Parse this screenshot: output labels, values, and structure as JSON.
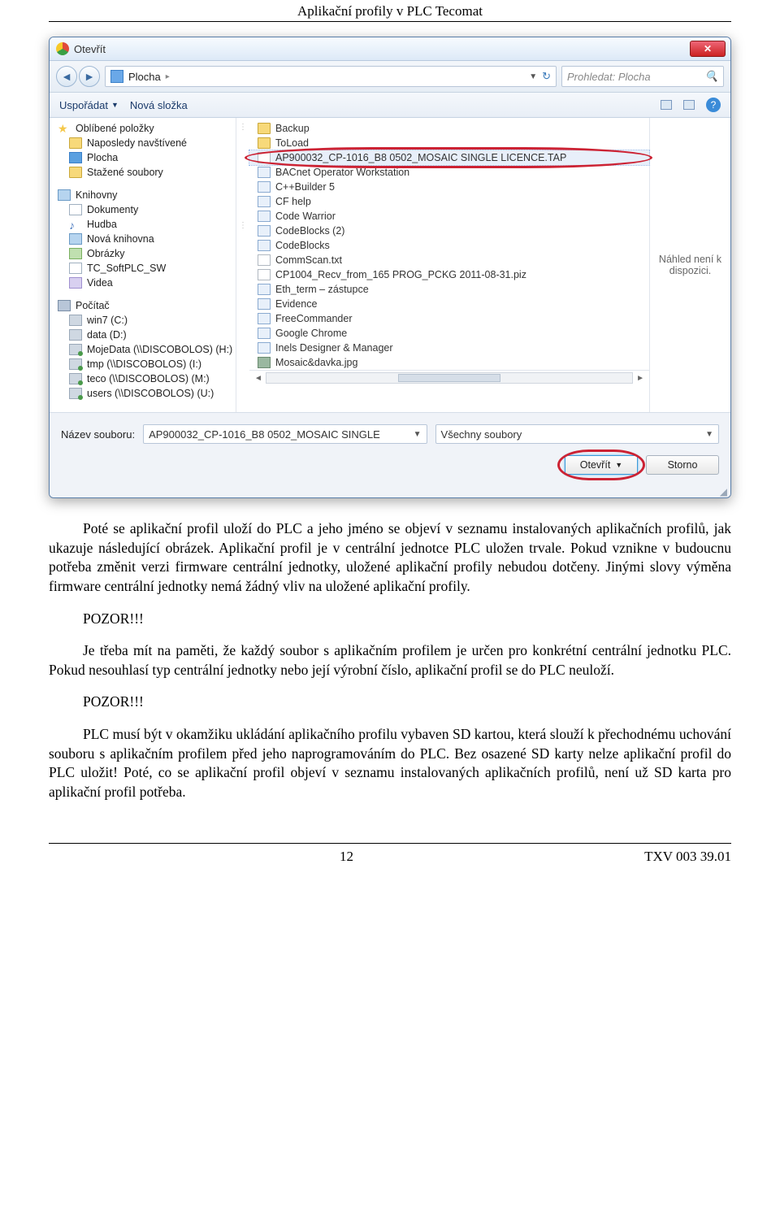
{
  "doc": {
    "header": "Aplikační profily v PLC Tecomat",
    "page_no": "12",
    "footer_code": "TXV 003 39.01"
  },
  "dialog": {
    "title": "Otevřít",
    "breadcrumb": "Plocha",
    "breadcrumb_sep": "▸",
    "search_placeholder": "Prohledat: Plocha",
    "toolbar": {
      "organize": "Uspořádat",
      "newfolder": "Nová složka"
    },
    "sidebar": {
      "favorites": "Oblíbené položky",
      "recent": "Naposledy navštívené",
      "desktop": "Plocha",
      "downloads": "Stažené soubory",
      "libraries": "Knihovny",
      "documents": "Dokumenty",
      "music": "Hudba",
      "newlib": "Nová knihovna",
      "pictures": "Obrázky",
      "tcsoft": "TC_SoftPLC_SW",
      "videos": "Videa",
      "computer": "Počítač",
      "drive_c": "win7 (C:)",
      "drive_d": "data (D:)",
      "net_h": "MojeData (\\\\DISCOBOLOS) (H:)",
      "net_i": "tmp (\\\\DISCOBOLOS) (I:)",
      "net_m": "teco (\\\\DISCOBOLOS) (M:)",
      "net_u": "users (\\\\DISCOBOLOS) (U:)"
    },
    "files": [
      "Backup",
      "ToLoad",
      "AP900032_CP-1016_B8 0502_MOSAIC SINGLE LICENCE.TAP",
      "BACnet Operator Workstation",
      "C++Builder 5",
      "CF help",
      "Code Warrior",
      "CodeBlocks (2)",
      "CodeBlocks",
      "CommScan.txt",
      "CP1004_Recv_from_165 PROG_PCKG 2011-08-31.piz",
      "Eth_term – zástupce",
      "Evidence",
      "FreeCommander",
      "Google Chrome",
      "Inels Designer & Manager",
      "Mosaic&davka.jpg"
    ],
    "selected_index": 2,
    "preview_text": "Náhled není k dispozici.",
    "filename_label": "Název souboru:",
    "filename_value": "AP900032_CP-1016_B8 0502_MOSAIC SINGLE",
    "filter": "Všechny soubory",
    "open_btn": "Otevřít",
    "cancel_btn": "Storno"
  },
  "text": {
    "p1": "Poté se aplikační profil uloží do PLC a jeho jméno se objeví v seznamu instalovaných aplikačních profilů, jak ukazuje následující obrázek. Aplikační profil je v centrální jednotce PLC uložen trvale. Pokud vznikne v budoucnu potřeba změnit verzi firmware centrální jednotky, uložené aplikační profily nebudou dotčeny. Jinými slovy výměna firmware centrální jednotky nemá žádný vliv na uložené aplikační profily.",
    "pozor1": "POZOR!!!",
    "p2": "Je třeba mít na paměti, že každý soubor s aplikačním profilem je určen pro konkrétní centrální jednotku PLC. Pokud nesouhlasí typ centrální jednotky nebo její výrobní číslo, aplikační profil se do PLC neuloží.",
    "pozor2": "POZOR!!!",
    "p3": "PLC musí být v okamžiku ukládání aplikačního profilu vybaven SD kartou, která slouží k přechodnému uchování souboru s aplikačním profilem před jeho naprogramováním do PLC. Bez osazené SD karty nelze aplikační profil do PLC uložit! Poté, co se aplikační profil objeví v seznamu instalovaných aplikačních profilů, není už SD karta pro aplikační profil potřeba."
  }
}
